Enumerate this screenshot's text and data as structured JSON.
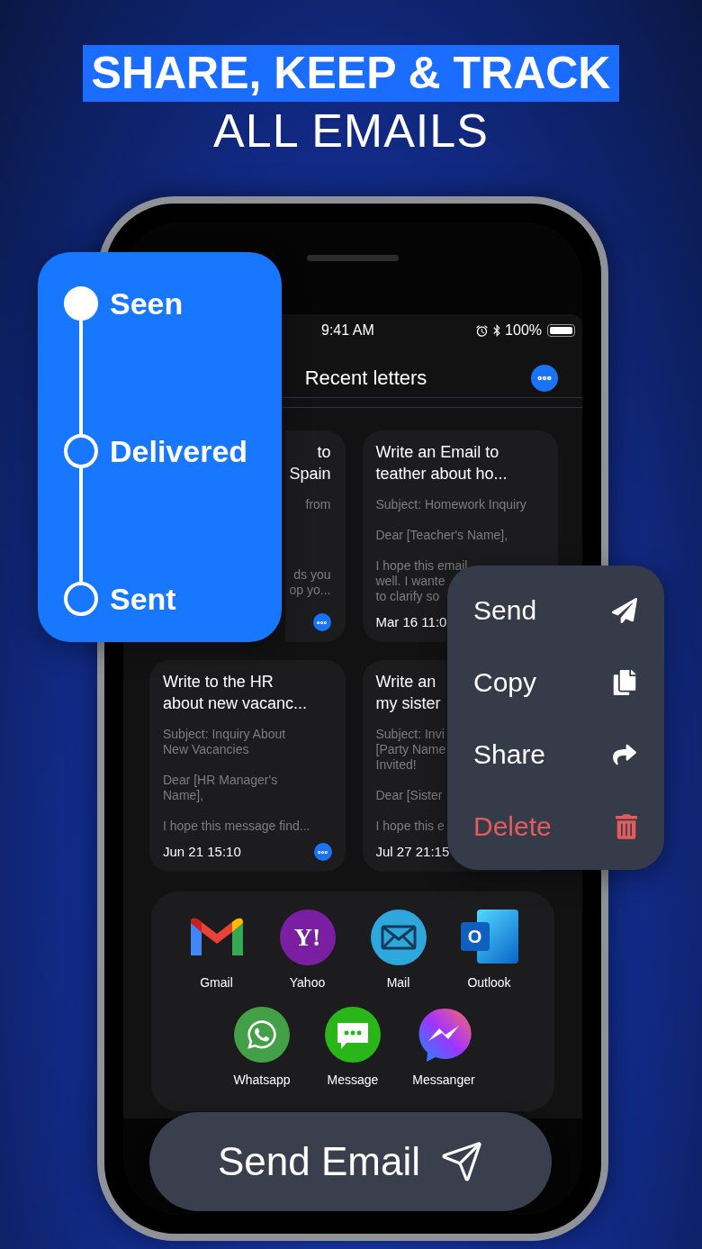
{
  "headline": {
    "highlight": "SHARE, KEEP & TRACK",
    "subtitle": "ALL EMAILS"
  },
  "status_bar": {
    "time": "9:41 AM",
    "battery": "100%"
  },
  "title": "Recent letters",
  "letters": [
    {
      "kind": "cut_left",
      "title": "to\nSpain",
      "body": [
        "from",
        "ds you\nop yo..."
      ],
      "more_button": true
    },
    {
      "kind": "full",
      "title": "Write an Email to\nteather about ho...",
      "body": [
        "Subject: Homework Inquiry",
        "Dear [Teacher's Name],",
        "I hope this email\nwell. I wante\nto clarify so"
      ],
      "date": "Mar 16 11:0"
    },
    {
      "kind": "full",
      "title": "Write to the HR\nabout new vacanc...",
      "body": [
        "Subject: Inquiry About\nNew Vacancies",
        "Dear [HR Manager's\nName],",
        "I hope this message find..."
      ],
      "date": "Jun 21 15:10",
      "more_button": true
    },
    {
      "kind": "full",
      "title": "Write an\nmy sister",
      "body": [
        "Subject: Invi\n[Party Name\nInvited!",
        "Dear [Sister",
        "I hope this e"
      ],
      "date": "Jul 27 21:15"
    }
  ],
  "share_sheet": {
    "rows": [
      [
        {
          "name": "Gmail",
          "kind": "gmail"
        },
        {
          "name": "Yahoo",
          "kind": "yahoo",
          "glyph": "Y!"
        },
        {
          "name": "Mail",
          "kind": "mail"
        },
        {
          "name": "Outlook",
          "kind": "outlook",
          "glyph": "O"
        }
      ],
      [
        {
          "name": "Whatsapp",
          "kind": "whatsapp"
        },
        {
          "name": "Message",
          "kind": "message"
        },
        {
          "name": "Messanger",
          "kind": "messenger"
        }
      ]
    ]
  },
  "send_button": "Send Email",
  "tracking": {
    "steps": [
      {
        "label": "Seen",
        "reached": true
      },
      {
        "label": "Delivered",
        "reached": false
      },
      {
        "label": "Sent",
        "reached": false
      }
    ]
  },
  "context_menu": {
    "items": [
      {
        "label": "Send",
        "kind": "normal"
      },
      {
        "label": "Copy",
        "kind": "normal"
      },
      {
        "label": "Share",
        "kind": "normal"
      },
      {
        "label": "Delete",
        "kind": "destructive"
      }
    ]
  }
}
